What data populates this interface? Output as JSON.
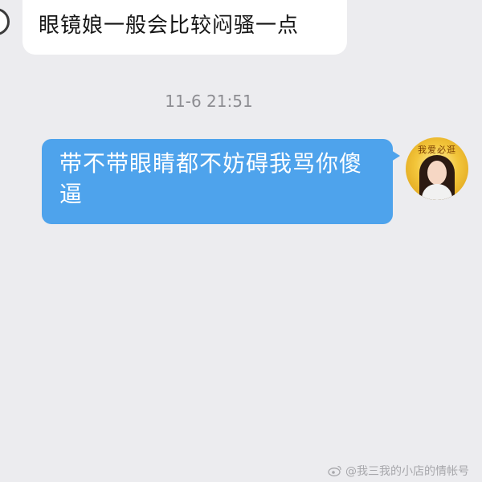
{
  "messages": {
    "incoming": {
      "text": "眼镜娘一般会比较闷骚一点"
    },
    "timestamp": "11-6 21:51",
    "outgoing": {
      "text": "带不带眼睛都不妨碍我骂你傻逼"
    }
  },
  "avatar": {
    "caption": "我爱必逛"
  },
  "watermark": {
    "text": "@我三我的小店的情帐号",
    "icon": "weibo-icon"
  },
  "colors": {
    "background": "#ececef",
    "incoming_bubble": "#ffffff",
    "outgoing_bubble": "#4ea3ec",
    "timestamp": "#8d8d92"
  }
}
